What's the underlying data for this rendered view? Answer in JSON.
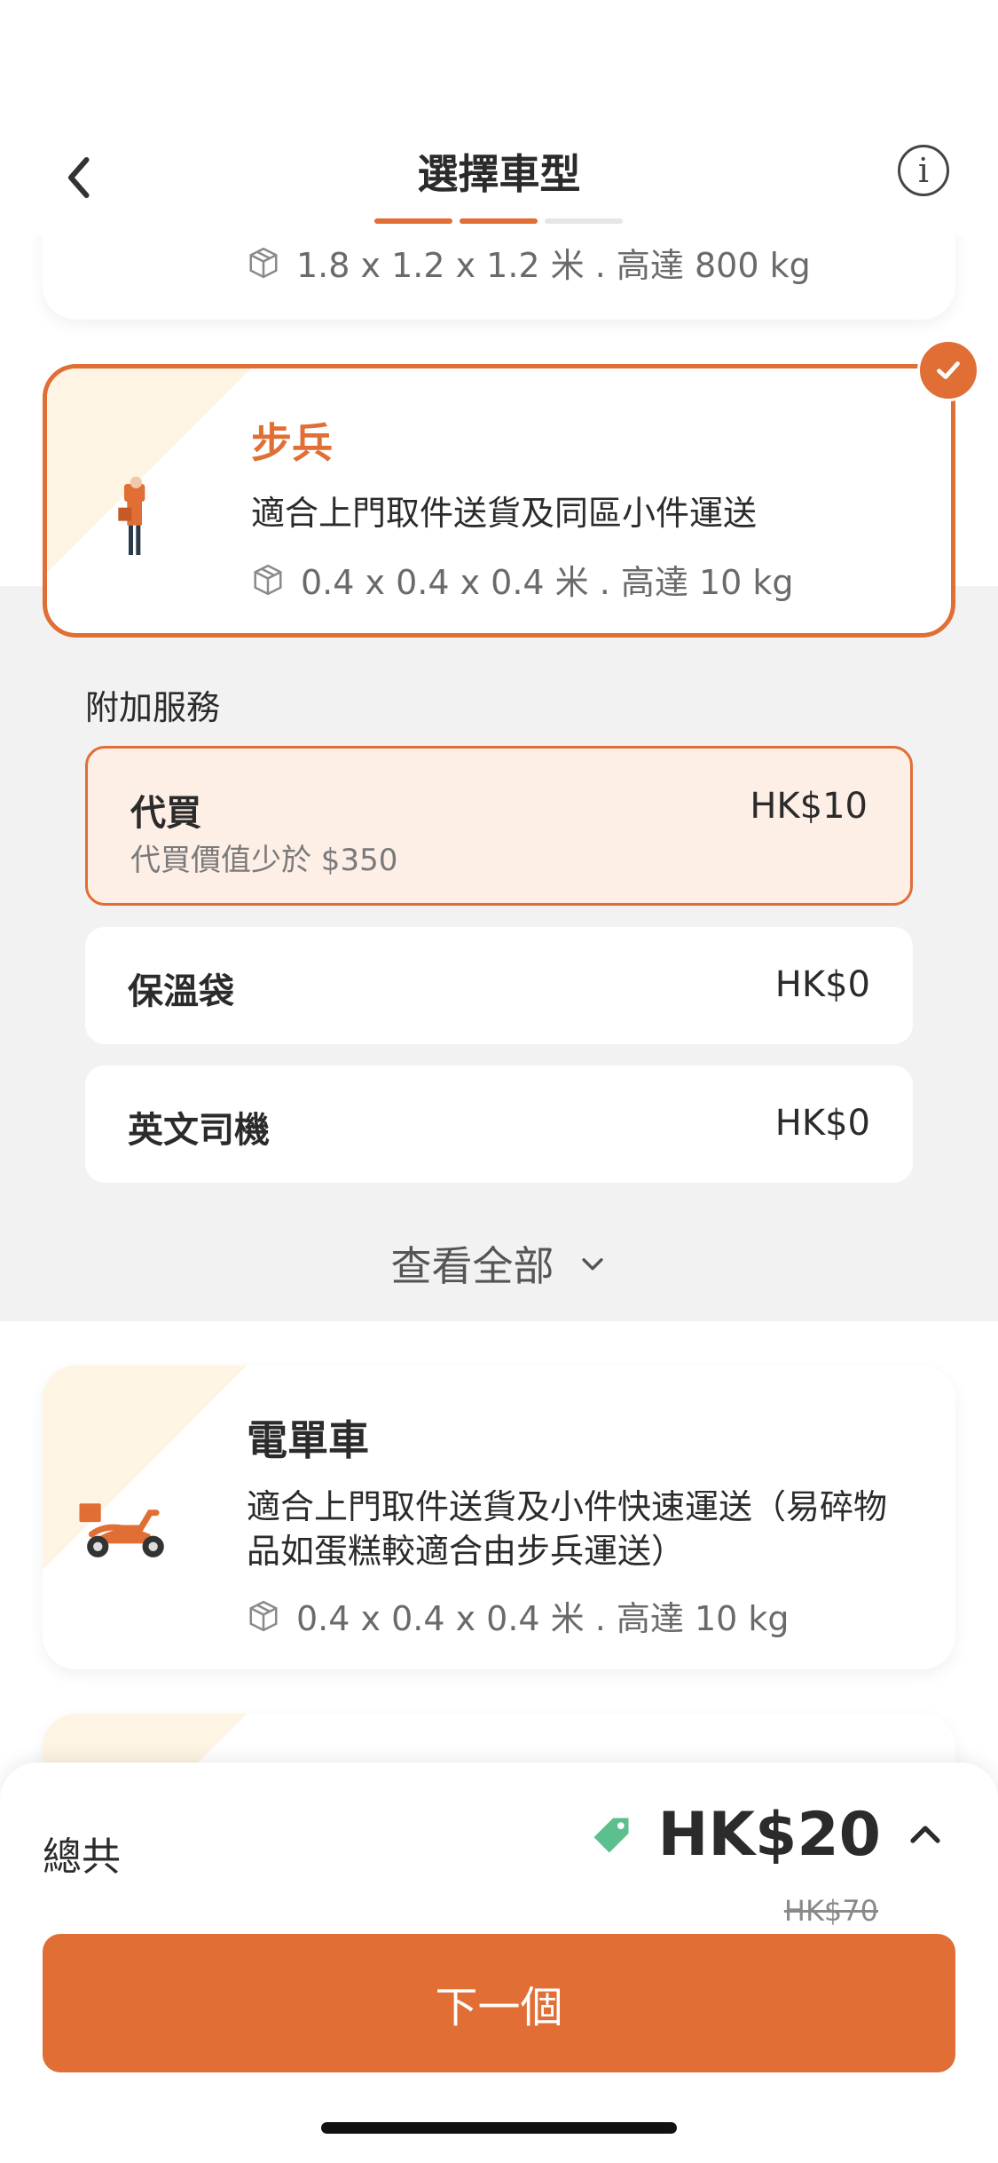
{
  "header": {
    "title": "選擇車型",
    "steps_done": 2,
    "steps_total": 3
  },
  "vehicles": [
    {
      "spec": "1.8 x 1.2 x 1.2 米 . 高達 800 kg"
    },
    {
      "name": "步兵",
      "description": "適合上門取件送貨及同區小件運送",
      "spec": "0.4 x 0.4 x 0.4 米 . 高達 10 kg",
      "selected": true
    },
    {
      "name": "電單車",
      "description": "適合上門取件送貨及小件快速運送（易碎物品如蛋糕較適合由步兵運送）",
      "spec": "0.4 x 0.4 x 0.4 米 . 高達 10 kg"
    }
  ],
  "addons": {
    "label": "附加服務",
    "items": [
      {
        "name": "代買",
        "price": "HK$10",
        "sub": "代買價值少於 $350",
        "selected": true
      },
      {
        "name": "保溫袋",
        "price": "HK$0"
      },
      {
        "name": "英文司機",
        "price": "HK$0"
      }
    ],
    "view_all": "查看全部"
  },
  "footer": {
    "total_label": "總共",
    "price": "HK$20",
    "original_price": "HK$70",
    "next_label": "下一個"
  },
  "colors": {
    "accent": "#e06e35",
    "tag": "#5bbf8e"
  }
}
